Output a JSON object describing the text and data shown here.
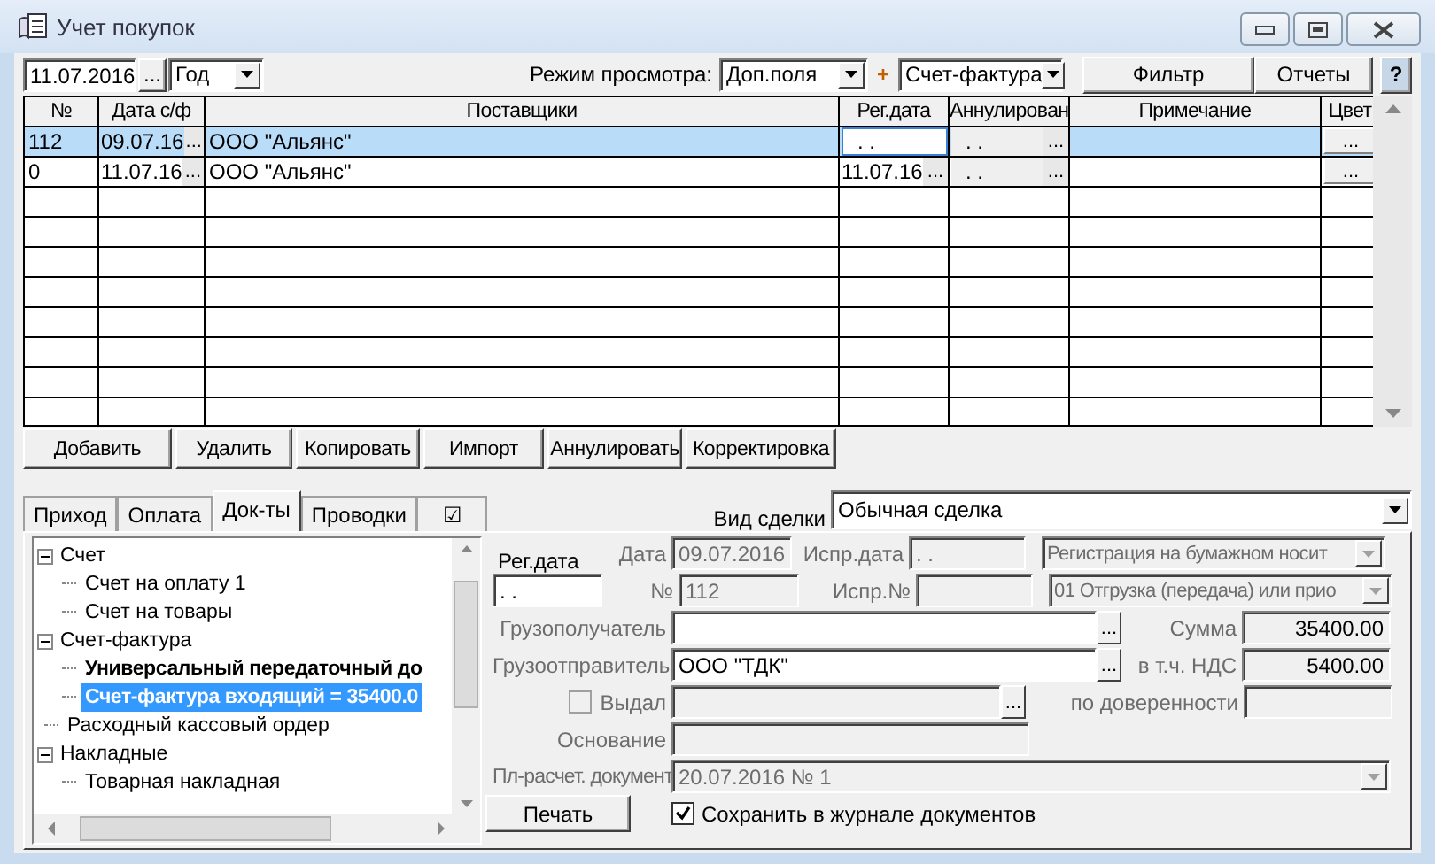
{
  "window": {
    "title": "Учет покупок"
  },
  "toolbar": {
    "date": "11.07.2016",
    "date_button": "...",
    "period": "Год",
    "view_mode_label": "Режим просмотра:",
    "view_mode": "Доп.поля",
    "plus": "+",
    "document_type": "Счет-фактура",
    "buttons": [
      "Фильтр",
      "Отчеты"
    ],
    "help": "?"
  },
  "table": {
    "columns": [
      "№",
      "Дата с/ф",
      "Поставщики",
      "Рег.дата",
      "Аннулирован",
      "Примечание",
      "Цвет"
    ],
    "rows": [
      {
        "selected": true,
        "number": "112",
        "invoice_date": "09.07.16",
        "invoice_date_button": "...",
        "supplier": "ООО \"Альянс\"",
        "reg_date": ". .",
        "annulled": ". .",
        "annulled_button": "...",
        "color_button": "..."
      },
      {
        "selected": false,
        "number": "0",
        "invoice_date": "11.07.16",
        "invoice_date_button": "...",
        "supplier": "ООО \"Альянс\"",
        "reg_date": "11.07.16",
        "reg_date_button": "...",
        "annulled": ". .",
        "annulled_button": "...",
        "color_button": "..."
      }
    ]
  },
  "actions": [
    "Добавить",
    "Удалить",
    "Копировать",
    "Импорт",
    "Аннулировать",
    "Корректировка"
  ],
  "tabs": [
    {
      "label": "Приход",
      "selected": false
    },
    {
      "label": "Оплата",
      "selected": false
    },
    {
      "label": "Док-ты",
      "selected": true
    },
    {
      "label": "Проводки",
      "selected": false
    },
    {
      "label": "☑",
      "selected": false
    }
  ],
  "deal_type": {
    "label": "Вид сделки",
    "value": "Обычная сделка"
  },
  "tree": {
    "items": [
      {
        "label": "Счет",
        "expanded": true,
        "selected": false,
        "children": [
          {
            "label": "Счет на оплату 1",
            "bold": false,
            "selected": false
          },
          {
            "label": "Счет на товары",
            "bold": false,
            "selected": false
          }
        ]
      },
      {
        "label": "Счет-фактура",
        "expanded": true,
        "selected": false,
        "children": [
          {
            "label": "Универсальный передаточный до",
            "bold": true,
            "selected": false
          },
          {
            "label": "Счет-фактура входящий = 35400.0",
            "bold": true,
            "selected": true
          }
        ]
      },
      {
        "label": "Расходный кассовый ордер",
        "selected": false
      },
      {
        "label": "Накладные",
        "expanded": true,
        "selected": false,
        "children": [
          {
            "label": "Товарная накладная",
            "bold": false,
            "selected": false
          }
        ]
      }
    ]
  },
  "document_form": {
    "reg_date": {
      "label": "Рег.дата",
      "value": ". .",
      "disabled": false
    },
    "date": {
      "label": "Дата",
      "value": "09.07.2016",
      "disabled": true
    },
    "number": {
      "label": "№",
      "value": "112",
      "disabled": true
    },
    "fix_date": {
      "label": "Испр.дата",
      "value": ". .",
      "disabled": true
    },
    "fix_number": {
      "label": "Испр.№",
      "disabled": true
    },
    "registration": {
      "value": "Регистрация на бумажном носит",
      "disabled": true
    },
    "operation_code": {
      "value": "01 Отгрузка (передача) или прио",
      "disabled": true
    },
    "consignee": {
      "label": "Грузополучатель",
      "button": "...",
      "disabled": false
    },
    "shipper": {
      "label": "Грузоотправитель",
      "value": "ООО \"ТДК\"",
      "button": "...",
      "disabled": false
    },
    "amount": {
      "label": "Сумма",
      "value": "35400.00",
      "disabled": true
    },
    "vat": {
      "label": "в т.ч. НДС",
      "value": "5400.00",
      "disabled": true
    },
    "issued": {
      "label": "Выдал",
      "checked": false,
      "button": "...",
      "disabled": true
    },
    "proxy": {
      "label": "по доверенности",
      "disabled": true
    },
    "basis": {
      "label": "Основание",
      "disabled": true
    },
    "payment_doc": {
      "label": "Пл-расчет. документ",
      "value": "20.07.2016 № 1",
      "disabled": true
    },
    "print_button": "Печать",
    "save_journal": {
      "label": "Сохранить в журнале документов",
      "checked": true
    }
  }
}
